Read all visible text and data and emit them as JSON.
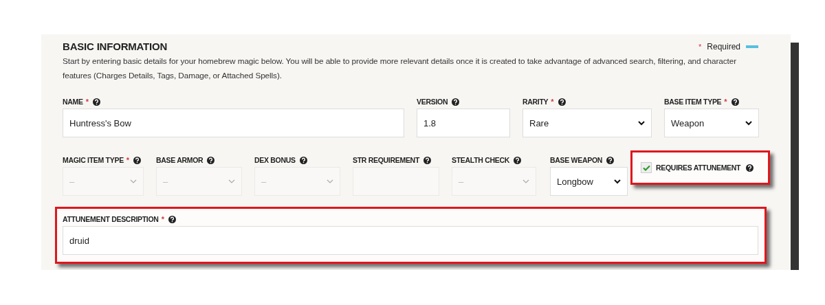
{
  "section": {
    "title": "BASIC INFORMATION",
    "legend_mark": "*",
    "legend_text": "Required",
    "description": "Start by entering basic details for your homebrew magic below. You will be able to provide more relevant details once it is created to take advantage of advanced search, filtering, and character features (Charges Details, Tags, Damage, or Attached Spells)."
  },
  "rows": [
    [
      {
        "kind": "text",
        "label": "NAME",
        "required_mark": "*",
        "help": true,
        "value": "Huntress's Bow",
        "disabled": false
      },
      {
        "kind": "text",
        "label": "VERSION",
        "help": true,
        "value": "1.8",
        "disabled": false
      },
      {
        "kind": "select",
        "label": "RARITY",
        "required_mark": "*",
        "help": true,
        "value": "Rare",
        "disabled": false
      },
      {
        "kind": "select",
        "label": "BASE ITEM TYPE",
        "required_mark": "*",
        "help": true,
        "value": "Weapon",
        "disabled": false
      }
    ],
    [
      {
        "kind": "select",
        "label": "MAGIC ITEM TYPE",
        "required_mark": "*",
        "help": true,
        "placeholder": "–",
        "disabled": true
      },
      {
        "kind": "select",
        "label": "BASE ARMOR",
        "help": true,
        "placeholder": "–",
        "disabled": true
      },
      {
        "kind": "select",
        "label": "DEX BONUS",
        "help": true,
        "placeholder": "–",
        "disabled": true
      },
      {
        "kind": "text",
        "label": "STR REQUIREMENT",
        "help": true,
        "disabled": true
      },
      {
        "kind": "select",
        "label": "STEALTH CHECK",
        "help": true,
        "placeholder": "–",
        "disabled": true
      },
      {
        "kind": "select",
        "label": "BASE WEAPON",
        "help": true,
        "value": "Longbow",
        "disabled": false
      },
      {
        "kind": "checkbox",
        "label": "REQUIRES ATTUNEMENT",
        "help": true,
        "checked": true,
        "highlighted": true
      }
    ],
    [
      {
        "kind": "text",
        "label": "ATTUNEMENT DESCRIPTION",
        "required_mark": "*",
        "help": true,
        "value": "druid",
        "disabled": false,
        "highlighted": true
      }
    ]
  ]
}
